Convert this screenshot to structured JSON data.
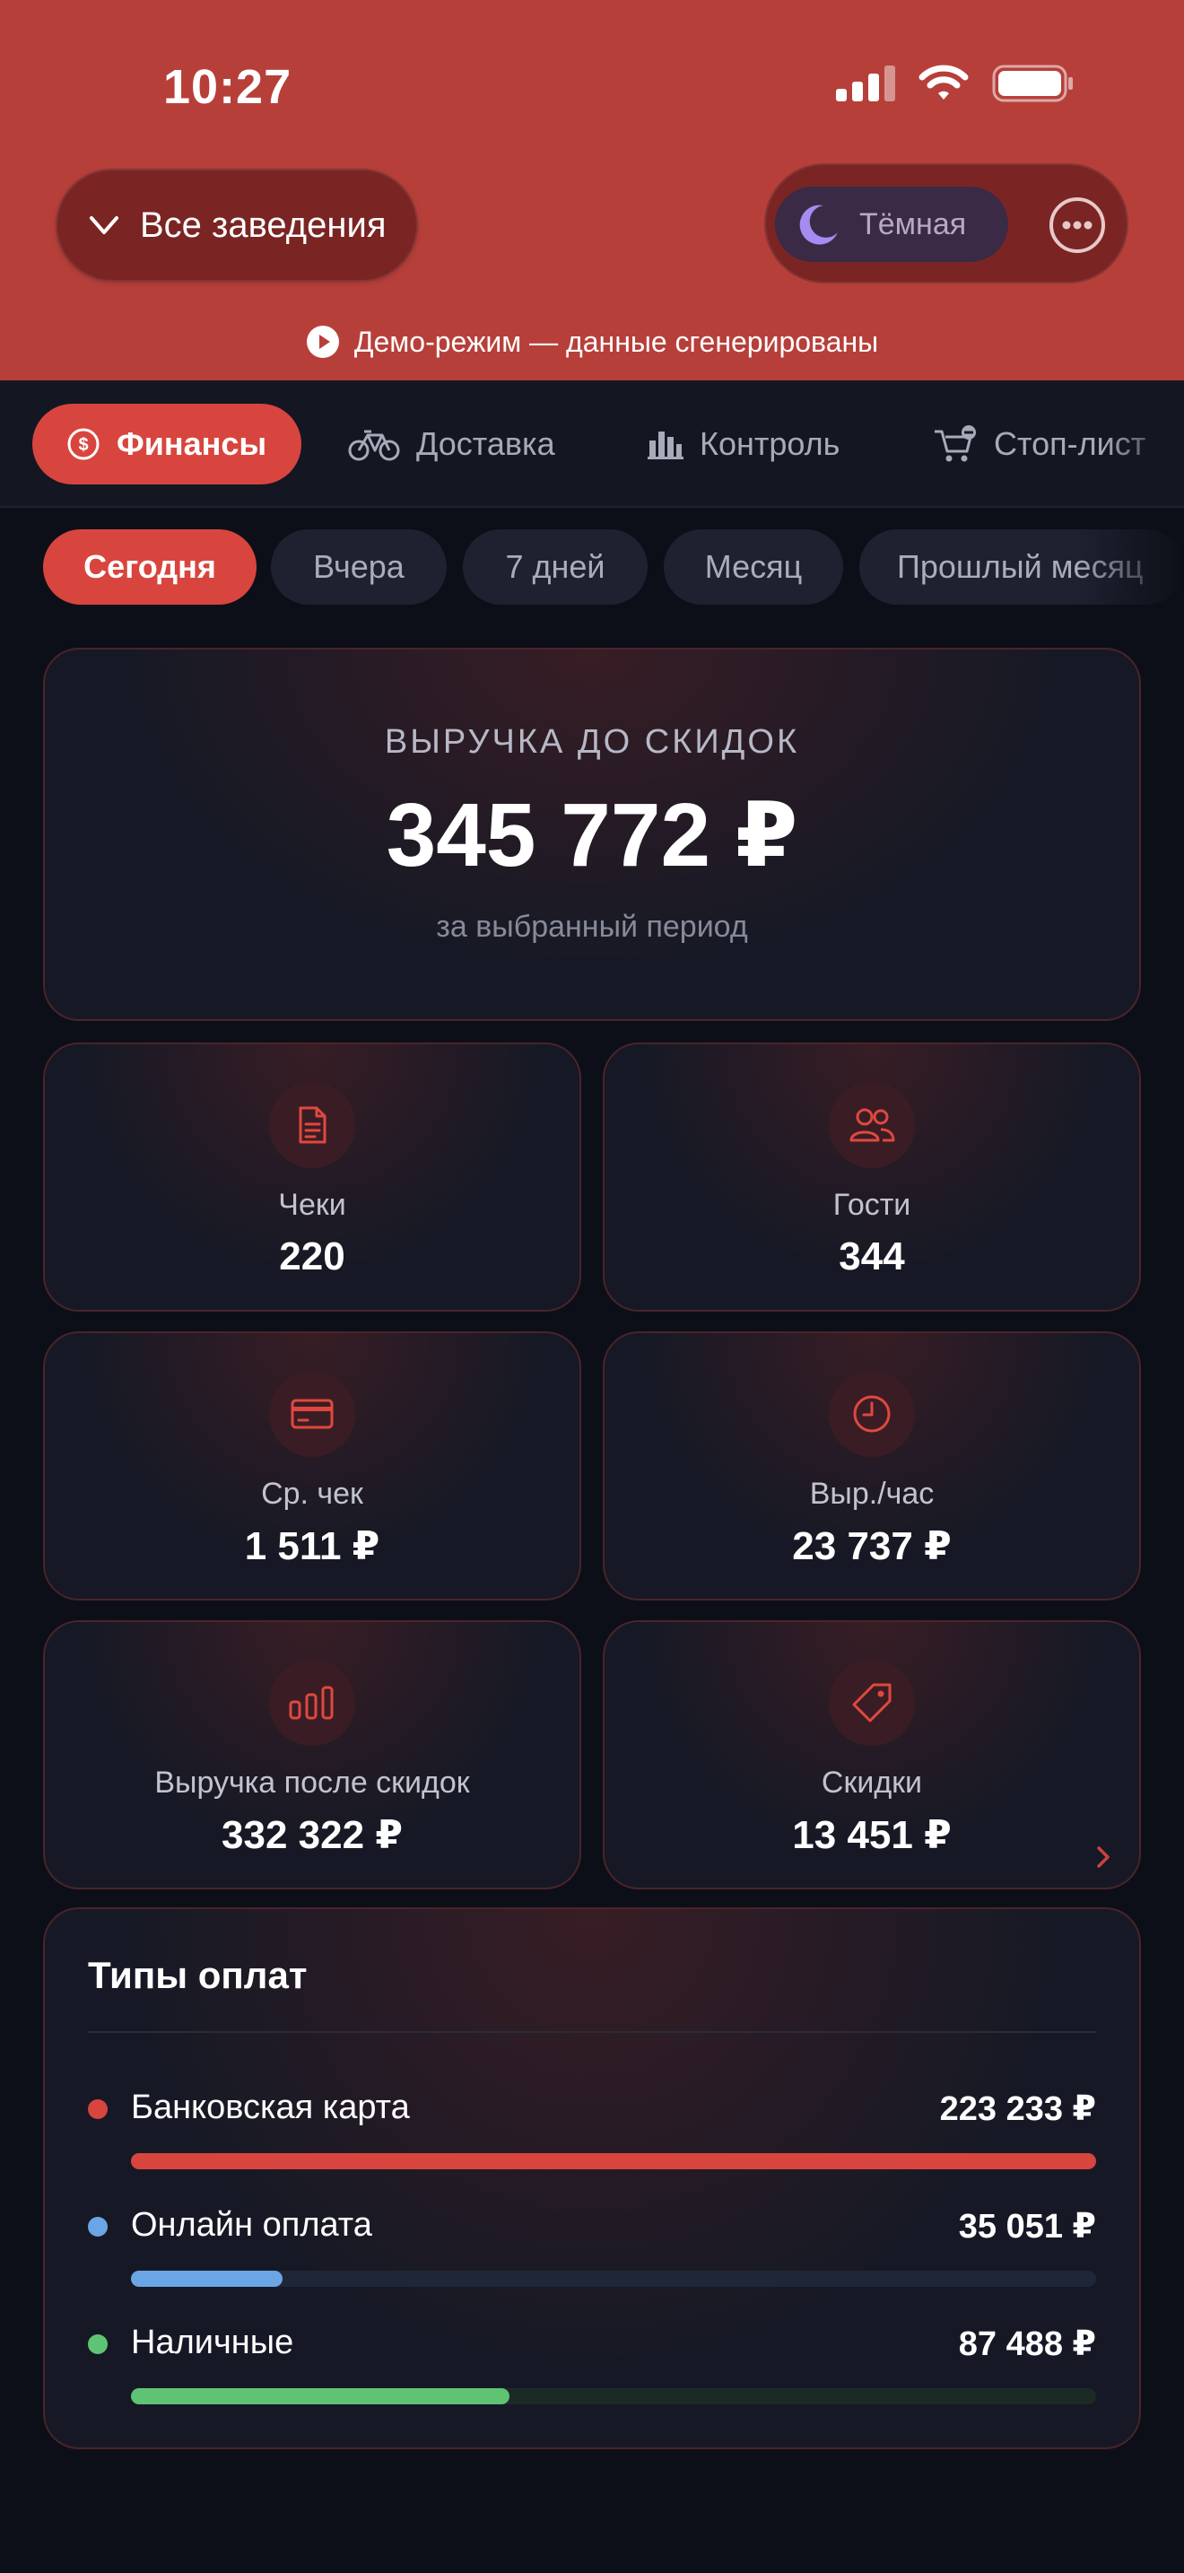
{
  "status": {
    "time": "10:27"
  },
  "header": {
    "venue_label": "Все заведения",
    "theme_label": "Тёмная",
    "demo_text": "Демо-режим — данные сгенерированы"
  },
  "tabs": [
    {
      "label": "Финансы",
      "icon": "dollar-circle-icon",
      "active": true
    },
    {
      "label": "Доставка",
      "icon": "bicycle-icon",
      "active": false
    },
    {
      "label": "Контроль",
      "icon": "bar-chart-icon",
      "active": false
    },
    {
      "label": "Стоп-лист",
      "icon": "cart-minus-icon",
      "active": false
    }
  ],
  "periods": [
    {
      "label": "Сегодня",
      "active": true
    },
    {
      "label": "Вчера",
      "active": false
    },
    {
      "label": "7 дней",
      "active": false
    },
    {
      "label": "Месяц",
      "active": false
    },
    {
      "label": "Прошлый месяц",
      "active": false
    }
  ],
  "hero": {
    "label": "ВЫРУЧКА ДО СКИДОК",
    "value": "345 772 ₽",
    "subtitle": "за выбранный период"
  },
  "metrics": [
    {
      "label": "Чеки",
      "value": "220",
      "icon": "receipt-icon"
    },
    {
      "label": "Гости",
      "value": "344",
      "icon": "users-icon"
    },
    {
      "label": "Ср. чек",
      "value": "1 511 ₽",
      "icon": "credit-card-icon"
    },
    {
      "label": "Выр./час",
      "value": "23 737 ₽",
      "icon": "clock-icon"
    },
    {
      "label": "Выручка после скидок",
      "value": "332 322 ₽",
      "icon": "bar-chart-icon"
    },
    {
      "label": "Скидки",
      "value": "13 451 ₽",
      "icon": "tag-icon"
    }
  ],
  "payments": {
    "title": "Типы оплат",
    "items": [
      {
        "name": "Банковская карта",
        "amount": "223 233 ₽",
        "fraction": 1.0,
        "color": "#d8453e",
        "track": "#3a1d24"
      },
      {
        "name": "Онлайн оплата",
        "amount": "35 051 ₽",
        "fraction": 0.157,
        "color": "#6aa5e6",
        "track": "#1f2638"
      },
      {
        "name": "Наличные",
        "amount": "87 488 ₽",
        "fraction": 0.392,
        "color": "#5ec474",
        "track": "#1c2a26"
      }
    ]
  },
  "colors": {
    "accent": "#d8453e",
    "header": "#b73f3a",
    "background": "#0d0f18"
  }
}
